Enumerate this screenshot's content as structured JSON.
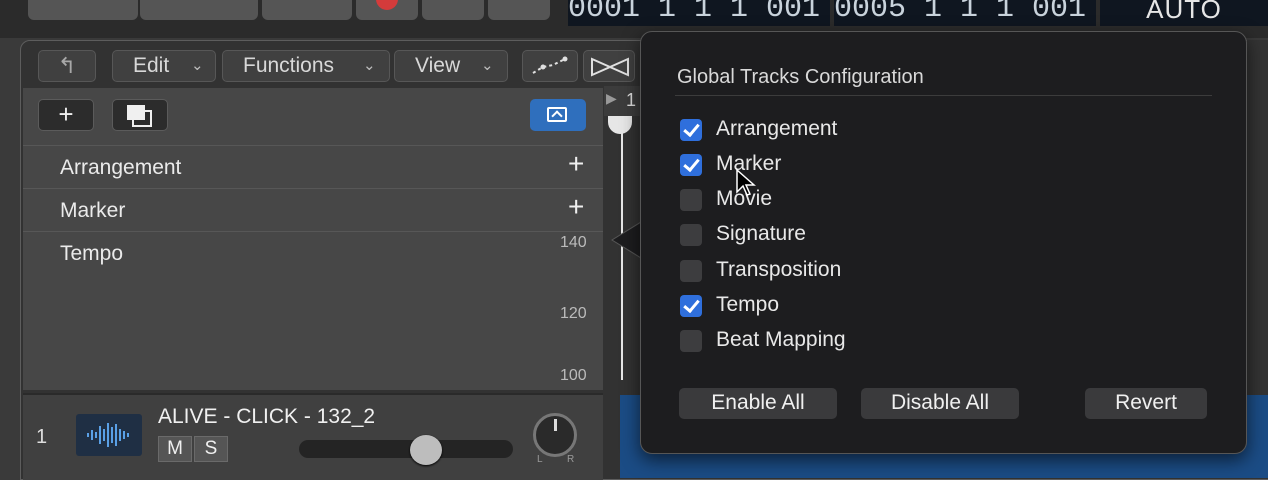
{
  "transport": {
    "lcd_position": "0001 1 1 1 001",
    "lcd_position2": "0005 1 1 1 001",
    "lcd_mode": "AUTO"
  },
  "toolbar": {
    "back_icon": "back-arrow-icon",
    "edit_label": "Edit",
    "functions_label": "Functions",
    "view_label": "View"
  },
  "track_header": {
    "add_symbol": "+",
    "global_tracks": [
      {
        "label": "Arrangement",
        "has_add": true
      },
      {
        "label": "Marker",
        "has_add": true
      },
      {
        "label": "Tempo",
        "has_add": false
      }
    ],
    "tempo_scale": [
      "140",
      "120",
      "100"
    ]
  },
  "audio_track": {
    "number": "1",
    "name": "ALIVE - CLICK - 132_2",
    "mute_label": "M",
    "solo_label": "S",
    "pan_left": "L",
    "pan_right": "R"
  },
  "ruler": {
    "bar_number": "1"
  },
  "popover": {
    "title": "Global Tracks Configuration",
    "options": [
      {
        "label": "Arrangement",
        "checked": true
      },
      {
        "label": "Marker",
        "checked": true
      },
      {
        "label": "Movie",
        "checked": false
      },
      {
        "label": "Signature",
        "checked": false
      },
      {
        "label": "Transposition",
        "checked": false
      },
      {
        "label": "Tempo",
        "checked": true
      },
      {
        "label": "Beat Mapping",
        "checked": false
      }
    ],
    "enable_all_label": "Enable All",
    "disable_all_label": "Disable All",
    "revert_label": "Revert"
  },
  "colors": {
    "accent": "#2f6fdc",
    "region": "#1b4c85"
  }
}
